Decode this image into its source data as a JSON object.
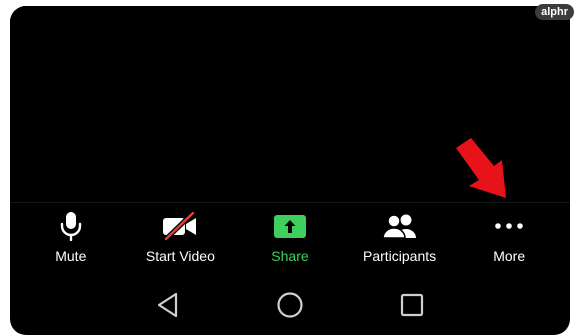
{
  "watermark": "alphr",
  "toolbar": {
    "mute_label": "Mute",
    "start_video_label": "Start Video",
    "share_label": "Share",
    "participants_label": "Participants",
    "more_label": "More"
  },
  "colors": {
    "background": "#000000",
    "label": "#ffffff",
    "share_accent": "#3fcf5d",
    "video_off_slash": "#e0413a",
    "annotation_arrow": "#e8121b"
  },
  "icons": {
    "mute": "microphone-icon",
    "start_video": "video-off-icon",
    "share": "share-screen-icon",
    "participants": "participants-icon",
    "more": "more-dots-icon",
    "nav_back": "back-triangle-icon",
    "nav_home": "home-circle-icon",
    "nav_recents": "recents-square-icon"
  }
}
